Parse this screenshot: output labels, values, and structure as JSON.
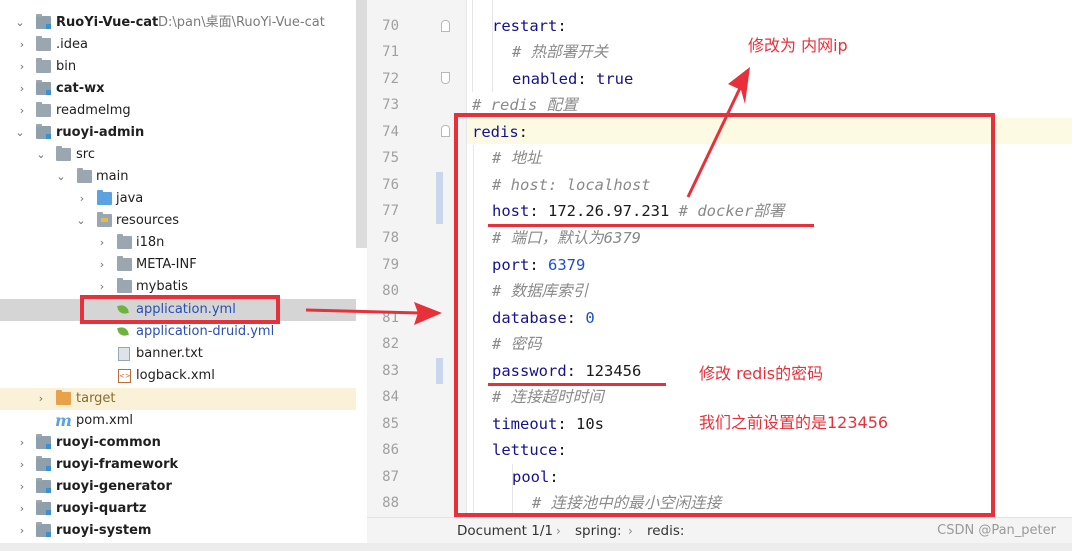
{
  "tree": {
    "root": {
      "name": "RuoYi-Vue-cat",
      "path": "D:\\pan\\桌面\\RuoYi-Vue-cat"
    },
    "items": [
      {
        "label": ".idea"
      },
      {
        "label": "bin"
      },
      {
        "label": "cat-wx"
      },
      {
        "label": "readmeImg"
      },
      {
        "label": "ruoyi-admin"
      },
      {
        "label": "src"
      },
      {
        "label": "main"
      },
      {
        "label": "java"
      },
      {
        "label": "resources"
      },
      {
        "label": "i18n"
      },
      {
        "label": "META-INF"
      },
      {
        "label": "mybatis"
      },
      {
        "label": "application.yml"
      },
      {
        "label": "application-druid.yml"
      },
      {
        "label": "banner.txt"
      },
      {
        "label": "logback.xml"
      },
      {
        "label": "target"
      },
      {
        "label": "pom.xml"
      },
      {
        "label": "ruoyi-common"
      },
      {
        "label": "ruoyi-framework"
      },
      {
        "label": "ruoyi-generator"
      },
      {
        "label": "ruoyi-quartz"
      },
      {
        "label": "ruoyi-system"
      }
    ]
  },
  "editor": {
    "line_numbers": [
      "70",
      "71",
      "72",
      "73",
      "74",
      "75",
      "76",
      "77",
      "78",
      "79",
      "80",
      "81",
      "82",
      "83",
      "84",
      "85",
      "86",
      "87",
      "88"
    ],
    "lines": [
      {
        "key": "restart",
        "colon": ":"
      },
      {
        "comment": "# 热部署开关"
      },
      {
        "key": "enabled",
        "colon": ": ",
        "value": "true"
      },
      {
        "comment": "# redis 配置"
      },
      {
        "key": "redis",
        "colon": ":"
      },
      {
        "comment": "# 地址"
      },
      {
        "comment": "# host: localhost"
      },
      {
        "key": "host",
        "colon": ": ",
        "value": "172.26.97.231",
        "comment": " # docker部署"
      },
      {
        "comment": "# 端口，默认为6379"
      },
      {
        "key": "port",
        "colon": ": ",
        "value": "6379"
      },
      {
        "comment": "# 数据库索引"
      },
      {
        "key": "database",
        "colon": ": ",
        "value": "0"
      },
      {
        "comment": "# 密码"
      },
      {
        "key": "password",
        "colon": ": ",
        "value": "123456"
      },
      {
        "comment": "# 连接超时时间"
      },
      {
        "key": "timeout",
        "colon": ": ",
        "value": "10s"
      },
      {
        "key": "lettuce",
        "colon": ":"
      },
      {
        "key": "pool",
        "colon": ":"
      },
      {
        "comment": "# 连接池中的最小空闲连接"
      }
    ]
  },
  "status": {
    "document": "Document 1/1",
    "crumb1": "spring:",
    "crumb2": "redis:",
    "watermark": "CSDN @Pan_peter"
  },
  "annotations": {
    "note_ip": "修改为 内网ip",
    "note_redis": "修改 redis的密码",
    "note_pwd": "我们之前设置的是123456"
  },
  "colors": {
    "annotation": "#e8303a",
    "key": "#14138d",
    "number": "#1b4fd6",
    "comment": "#8a8a8a"
  }
}
